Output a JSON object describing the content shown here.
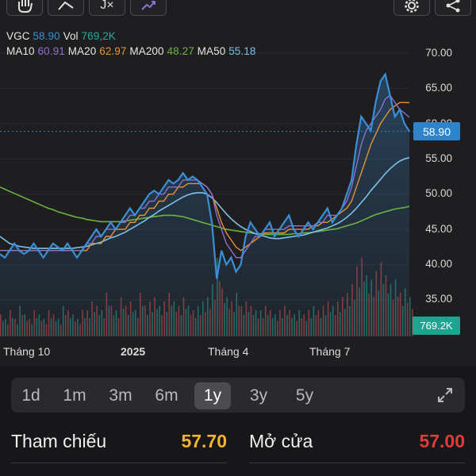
{
  "toolbar": {
    "buttons": [
      {
        "icon": "hand-icon"
      },
      {
        "icon": "trendline-icon"
      },
      {
        "icon": "function-icon",
        "label": "J×"
      },
      {
        "icon": "compare-icon"
      },
      {
        "icon": "gear-icon"
      },
      {
        "icon": "share-icon"
      }
    ]
  },
  "legend": {
    "symbol": "VGC",
    "price": "58.90",
    "vol_label": "Vol",
    "vol": "769,2K",
    "ma10_label": "MA10",
    "ma10": "60.91",
    "ma20_label": "MA20",
    "ma20": "62.97",
    "ma200_label": "MA200",
    "ma200": "48.27",
    "ma50_label": "MA50",
    "ma50": "55.18"
  },
  "colors": {
    "price": "#3b8fd6",
    "vol": "#1fae9c",
    "ma10": "#8d6fd1",
    "ma20": "#e8922f",
    "ma200": "#6bb340",
    "ma50": "#7dc0e8",
    "up": "#e04a4a",
    "down": "#2aa58f",
    "ref": "#f2b52b",
    "open": "#e33b3b",
    "price_tag": "#2f83c9",
    "vol_tag": "#1ea592"
  },
  "chart_data": {
    "type": "line",
    "y_ticks": [
      "70.00",
      "65.00",
      "60.00",
      "55.00",
      "50.00",
      "45.00",
      "40.00",
      "35.00"
    ],
    "ylim": [
      32,
      72
    ],
    "x_labels": [
      "Tháng 10",
      "2025",
      "Tháng 4",
      "Tháng 7"
    ],
    "last_price_tag": "58.90",
    "last_volume_tag": "769.2K",
    "series": [
      {
        "name": "VGC",
        "values": [
          41.5,
          41,
          42,
          43,
          42,
          41.5,
          42,
          43,
          42,
          41,
          42,
          43,
          42.5,
          42,
          43,
          42,
          41,
          42,
          43,
          44,
          45,
          44,
          45,
          46,
          45,
          46,
          47,
          48,
          47,
          48,
          49,
          50,
          50.5,
          50,
          51,
          52,
          51.5,
          52,
          53,
          52,
          52.5,
          52,
          51,
          50,
          46,
          38,
          42,
          40,
          41,
          39,
          40,
          44,
          46,
          45,
          44,
          45,
          46,
          44,
          45,
          46,
          47,
          45,
          44,
          45,
          46,
          45,
          46,
          47,
          48,
          46,
          47,
          48,
          50,
          52,
          57,
          61,
          60,
          59,
          63,
          66,
          67,
          64,
          61,
          62,
          60,
          58.9
        ]
      },
      {
        "name": "MA10",
        "values": [
          42,
          42,
          42,
          42,
          42,
          42,
          42,
          42,
          42,
          42,
          42,
          42,
          42,
          42,
          42,
          42,
          42,
          42,
          43,
          43,
          44,
          44,
          45,
          45,
          45,
          46,
          46,
          47,
          47,
          48,
          48,
          49,
          49,
          50,
          50,
          51,
          51,
          51,
          52,
          52,
          52,
          52,
          51.5,
          51,
          50,
          47,
          45,
          43,
          42,
          41,
          41,
          42,
          43,
          44,
          44,
          45,
          45,
          45,
          45,
          45,
          45.5,
          45.5,
          45.5,
          45.5,
          45.5,
          45.5,
          46,
          46,
          47,
          47,
          47,
          48,
          49,
          51,
          54,
          57,
          59,
          60,
          61,
          62,
          63.5,
          64,
          63,
          62,
          61.5,
          60.9
        ]
      },
      {
        "name": "MA20",
        "values": [
          42,
          42,
          42,
          42,
          42,
          42,
          42,
          42,
          42,
          42,
          42,
          42,
          42,
          42,
          42,
          42,
          42,
          42,
          42,
          43,
          43,
          43,
          44,
          44,
          45,
          45,
          45,
          46,
          46,
          47,
          47,
          48,
          48,
          49,
          49,
          50,
          50,
          51,
          51,
          51.5,
          51.5,
          51.5,
          51.5,
          51,
          50,
          48,
          46,
          44.5,
          43.5,
          42.5,
          42,
          42.5,
          43,
          43.5,
          44,
          44.5,
          44.5,
          44.5,
          44.5,
          44.5,
          45,
          45,
          45,
          45,
          45,
          45.5,
          45.5,
          46,
          46,
          46.5,
          47,
          47.5,
          48,
          49,
          51,
          53,
          55,
          57,
          58.5,
          60,
          61,
          62,
          62.5,
          63,
          63,
          62.97
        ]
      },
      {
        "name": "MA50",
        "values": [
          44,
          43.5,
          43,
          42.8,
          42.6,
          42.5,
          42.4,
          42.3,
          42.3,
          42.3,
          42.3,
          42.3,
          42.3,
          42.3,
          42.3,
          42.3,
          42.4,
          42.5,
          42.6,
          42.8,
          43,
          43.2,
          43.5,
          43.8,
          44,
          44.3,
          44.6,
          45,
          45.4,
          45.8,
          46.2,
          46.7,
          47.1,
          47.6,
          48,
          48.4,
          48.8,
          49.2,
          49.6,
          49.9,
          50.1,
          50.2,
          50.2,
          50,
          49.5,
          48.8,
          48,
          47.2,
          46.5,
          45.9,
          45.4,
          45,
          44.7,
          44.4,
          44.2,
          44,
          43.8,
          43.7,
          43.7,
          43.8,
          43.9,
          44,
          44.1,
          44.2,
          44.4,
          44.6,
          44.8,
          45,
          45.2,
          45.5,
          45.8,
          46.2,
          46.7,
          47.3,
          48,
          48.8,
          49.6,
          50.5,
          51.3,
          52.1,
          52.9,
          53.6,
          54.2,
          54.7,
          55.0,
          55.18
        ]
      },
      {
        "name": "MA200",
        "values": [
          51,
          50.7,
          50.4,
          50.1,
          49.8,
          49.5,
          49.2,
          48.9,
          48.6,
          48.3,
          48,
          47.8,
          47.5,
          47.3,
          47.1,
          46.9,
          46.7,
          46.6,
          46.4,
          46.3,
          46.2,
          46.1,
          46.1,
          46.1,
          46.1,
          46.1,
          46.2,
          46.3,
          46.4,
          46.5,
          46.6,
          46.7,
          46.8,
          46.9,
          47,
          47,
          47,
          46.9,
          46.8,
          46.6,
          46.4,
          46.2,
          46,
          45.8,
          45.6,
          45.4,
          45.2,
          45,
          44.9,
          44.8,
          44.7,
          44.6,
          44.5,
          44.4,
          44.4,
          44.3,
          44.3,
          44.3,
          44.3,
          44.3,
          44.3,
          44.4,
          44.4,
          44.5,
          44.5,
          44.6,
          44.7,
          44.8,
          44.9,
          45,
          45.1,
          45.3,
          45.5,
          45.7,
          45.9,
          46.2,
          46.5,
          46.8,
          47.1,
          47.3,
          47.5,
          47.7,
          47.9,
          48.0,
          48.1,
          48.27
        ]
      }
    ],
    "volume_relative": [
      0.25,
      0.2,
      0.3,
      0.2,
      0.35,
      0.25,
      0.2,
      0.3,
      0.25,
      0.2,
      0.3,
      0.25,
      0.2,
      0.35,
      0.3,
      0.25,
      0.2,
      0.3,
      0.3,
      0.4,
      0.35,
      0.3,
      0.5,
      0.35,
      0.3,
      0.45,
      0.35,
      0.4,
      0.3,
      0.5,
      0.35,
      0.4,
      0.45,
      0.35,
      0.4,
      0.5,
      0.4,
      0.35,
      0.45,
      0.35,
      0.3,
      0.35,
      0.4,
      0.45,
      0.6,
      0.9,
      0.55,
      0.45,
      0.4,
      0.5,
      0.35,
      0.4,
      0.35,
      0.3,
      0.3,
      0.35,
      0.3,
      0.25,
      0.3,
      0.35,
      0.3,
      0.25,
      0.3,
      0.25,
      0.3,
      0.35,
      0.3,
      0.35,
      0.4,
      0.35,
      0.4,
      0.45,
      0.5,
      0.6,
      0.8,
      0.9,
      0.7,
      0.65,
      0.75,
      0.85,
      0.7,
      0.6,
      0.65,
      0.5,
      0.55,
      0.45
    ]
  },
  "periods": [
    "1d",
    "1m",
    "3m",
    "6m",
    "1y",
    "3y",
    "5y"
  ],
  "active_period": "1y",
  "stats": {
    "ref_label": "Tham chiếu",
    "ref_value": "57.70",
    "open_label": "Mở cửa",
    "open_value": "57.00"
  }
}
